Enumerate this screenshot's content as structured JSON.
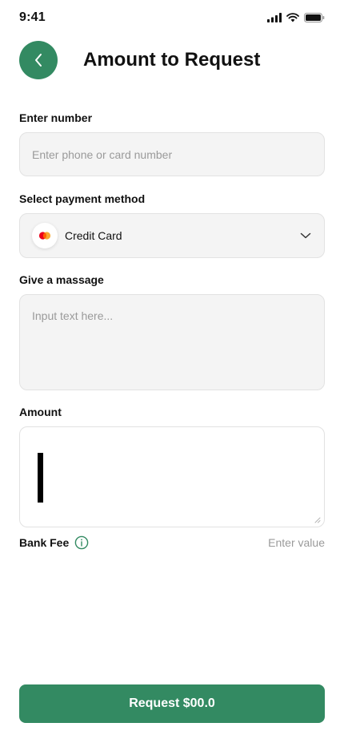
{
  "status_bar": {
    "time": "9:41"
  },
  "header": {
    "title": "Amount to Request"
  },
  "number": {
    "label": "Enter number",
    "placeholder": "Enter phone or card number",
    "value": ""
  },
  "payment": {
    "label": "Select payment method",
    "selected": "Credit Card",
    "icon": "mastercard-icon"
  },
  "message": {
    "label": "Give a massage",
    "placeholder": "Input text here...",
    "value": ""
  },
  "amount": {
    "label": "Amount",
    "value": ""
  },
  "fee": {
    "label": "Bank Fee",
    "value": "Enter value"
  },
  "request_button": {
    "label": "Request $00.0"
  },
  "colors": {
    "accent": "#338a62",
    "field_bg": "#f4f4f4",
    "placeholder": "#9a9a9a"
  }
}
